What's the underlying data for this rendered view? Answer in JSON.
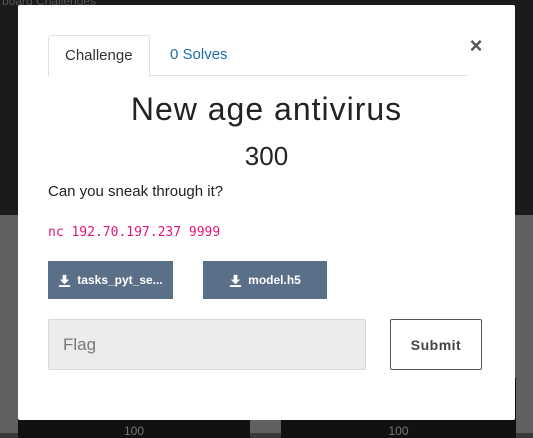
{
  "backdrop": {
    "top_text": "board   Challenges",
    "card_1_number": "100",
    "card_2_number": "100"
  },
  "modal": {
    "tabs": [
      {
        "label": "Challenge"
      },
      {
        "label": "0 Solves"
      }
    ],
    "close_icon": "×",
    "challenge": {
      "name": "New age antivirus",
      "points": "300",
      "description": "Can you sneak through it?",
      "connection": "nc 192.70.197.237 9999"
    },
    "files": [
      {
        "label": "tasks_pyt_se...",
        "icon": "download-icon"
      },
      {
        "label": "model.h5",
        "icon": "download-icon"
      }
    ],
    "flag_input": {
      "placeholder": "Flag",
      "value": ""
    },
    "submit_label": "Submit"
  },
  "colors": {
    "tab_link": "#1e6ca8",
    "connection_text": "#e4157a",
    "file_button": "#5a6f88"
  }
}
